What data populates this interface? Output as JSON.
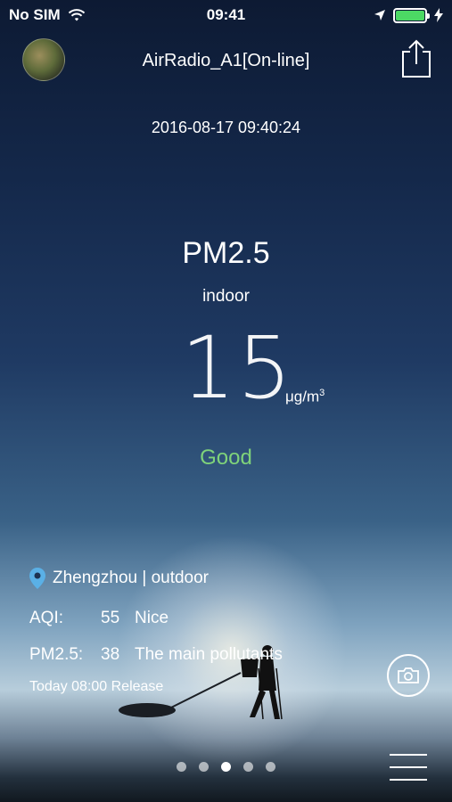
{
  "status_bar": {
    "carrier": "No SIM",
    "time": "09:41",
    "icons": [
      "wifi-icon",
      "location-arrow-icon",
      "battery-icon",
      "charging-bolt-icon"
    ],
    "battery_color": "#4cd964"
  },
  "header": {
    "title": "AirRadio_A1[On-line]",
    "avatar_icon": "avatar",
    "share_icon": "share-icon"
  },
  "reading": {
    "datetime": "2016-08-17 09:40:24",
    "metric": "PM2.5",
    "location": "indoor",
    "value": "15",
    "unit": "μg/m",
    "unit_sup": "3",
    "status": "Good",
    "status_color": "#7fd37a"
  },
  "outdoor": {
    "place": "Zhengzhou | outdoor",
    "aqi_label": "AQI:",
    "aqi_value": "55",
    "aqi_desc": "Nice",
    "pm_label": "PM2.5:",
    "pm_value": "38",
    "pm_desc": "The main pollutants",
    "release": "Today 08:00 Release"
  },
  "pager": {
    "count": 5,
    "active_index": 2
  },
  "toolbar": {
    "camera_icon": "camera-icon",
    "menu_icon": "menu-icon"
  }
}
